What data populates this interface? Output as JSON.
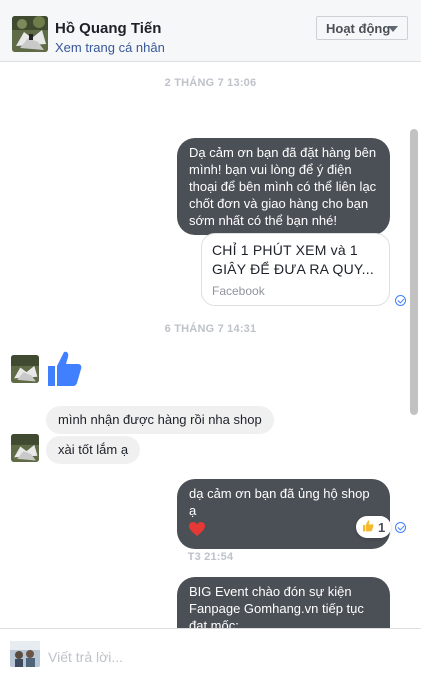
{
  "header": {
    "name": "Hồ Quang Tiến",
    "profile_link": "Xem trang cá nhân",
    "status_button": "Hoạt động"
  },
  "thread": {
    "separators": [
      "2 THÁNG 7 13:06",
      "6 THÁNG 7 14:31",
      "T3 21:54"
    ],
    "out_message_1": "Dạ cảm ơn bạn đã đặt hàng bên mình! bạn vui lòng để ý điện thoại để bên mình có thể liên lạc chốt đơn và giao hàng cho bạn sớm nhất có thể bạn nhé!",
    "link_card": {
      "title": "CHỈ 1 PHÚT XEM và 1 GIÂY ĐỂ ĐƯA RA QUY...",
      "source": "Facebook"
    },
    "in_message_1": "mình nhận được hàng rồi nha shop",
    "in_message_2": "xài tốt lắm ạ",
    "out_message_2": "dạ cảm ơn bạn đã ủng hộ shop ạ",
    "reaction_count": "1",
    "out_message_3": "BIG Event chào đón sự kiện Fanpage Gomhang.vn tiếp tục đạt mốc:"
  },
  "composer": {
    "placeholder": "Viết trả lời..."
  },
  "icons": {
    "thumbs_up": "thumbs-up-icon",
    "heart": "heart-icon",
    "seen": "seen-check-icon",
    "caret": "chevron-down-icon"
  },
  "colors": {
    "outgoing_bubble": "#4b4f56",
    "incoming_bubble": "#f1f0f0",
    "link": "#385898",
    "like_blue": "#4080ff",
    "heart_red": "#e53935"
  }
}
